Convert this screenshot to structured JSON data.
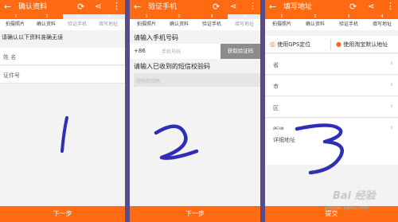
{
  "nav_icons": {
    "back": "back-arrow-icon",
    "refresh": "refresh-icon",
    "share": "share-icon",
    "more": "more-vertical-icon"
  },
  "colors": {
    "accent": "#ff6a12",
    "divider": "#5a4a86",
    "handwriting": "#2f2fb5"
  },
  "panel1": {
    "title": "确认资料",
    "steps": [
      {
        "num": "1",
        "label": "拍摄照片"
      },
      {
        "num": "2",
        "label": "确认资料"
      },
      {
        "num": "3",
        "label": "验证手机"
      },
      {
        "num": "4",
        "label": "填写地址"
      }
    ],
    "current_step": 2,
    "note": "请确认以下资料准确无误",
    "fields": [
      "姓 名",
      "证件号"
    ],
    "next": "下一步",
    "big_number": "1"
  },
  "panel2": {
    "title": "验证手机",
    "steps": [
      {
        "num": "1",
        "label": "拍摄照片"
      },
      {
        "num": "2",
        "label": "确认资料"
      },
      {
        "num": "3",
        "label": "验证手机"
      },
      {
        "num": "4",
        "label": "填写地址"
      }
    ],
    "current_step": 3,
    "phone_label": "请输入手机号码",
    "country_code": "+86",
    "phone_placeholder": "手机号码",
    "get_code": "获取验证码",
    "code_label": "请输入已收到的短信校验码",
    "code_placeholder": "短信校验码",
    "next": "下一步",
    "big_number": "2"
  },
  "panel3": {
    "title": "填写地址",
    "steps": [
      {
        "num": "1",
        "label": "拍摄照片"
      },
      {
        "num": "2",
        "label": "确认资料"
      },
      {
        "num": "3",
        "label": "验证手机"
      },
      {
        "num": "4",
        "label": "填写地址"
      }
    ],
    "current_step": 4,
    "gps": "使用GPS定位",
    "taobao": "使用淘宝默认地址",
    "rows": [
      "省",
      "市",
      "区",
      "街道"
    ],
    "detail": "详细地址",
    "submit": "提交",
    "big_number": "3"
  },
  "watermark": {
    "brand": "Bai 经验",
    "url": "jingyan.baidu.com"
  }
}
